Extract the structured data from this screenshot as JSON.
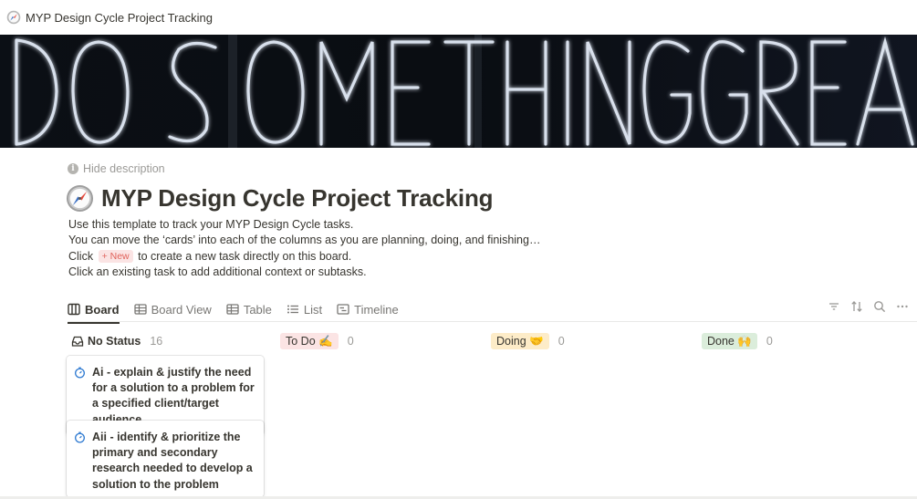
{
  "window": {
    "title": "MYP Design Cycle Project Tracking",
    "icon": "compass-icon"
  },
  "cover": {
    "text": "DO SOMETHING GREAT",
    "style": "neon-sign",
    "colors": {
      "background": "#07090d",
      "glow": "#dfe9f7"
    }
  },
  "description_toggle": {
    "label": "Hide description",
    "icon": "info-icon"
  },
  "page": {
    "title": "MYP Design Cycle Project Tracking",
    "icon": "compass-icon",
    "description": {
      "line1": "Use this template to track your MYP Design Cycle tasks.",
      "line2": "You can move the ‘cards’ into each of the columns as you are planning, doing, and finishing…",
      "line3_before": "Click",
      "line3_chip": "+ New",
      "line3_after": "to create a new task directly on this board.",
      "line4": "Click an existing task to add additional context or subtasks."
    }
  },
  "views": {
    "tabs": [
      {
        "label": "Board",
        "icon": "board-icon",
        "active": true
      },
      {
        "label": "Board View",
        "icon": "table-icon",
        "active": false
      },
      {
        "label": "Table",
        "icon": "table-icon",
        "active": false
      },
      {
        "label": "List",
        "icon": "list-icon",
        "active": false
      },
      {
        "label": "Timeline",
        "icon": "timeline-icon",
        "active": false
      }
    ],
    "toolbar": [
      "filter-icon",
      "sort-icon",
      "search-icon",
      "more-icon"
    ]
  },
  "board": {
    "columns": [
      {
        "label": "No Status",
        "count": "16",
        "icon": "inbox-icon"
      },
      {
        "label": "To Do ✍️",
        "count": "0",
        "color": "#fbe4e4"
      },
      {
        "label": "Doing 🤝",
        "count": "0",
        "color": "#fdecc8"
      },
      {
        "label": "Done 🙌",
        "count": "0",
        "color": "#dbeddb"
      }
    ],
    "cards": [
      {
        "text": "Ai - explain & justify the need for a solution to a problem for a specified client/target audience",
        "icon": "stopwatch-icon"
      },
      {
        "text": "Aii - identify & prioritize the primary and secondary research needed to develop a solution to the problem",
        "icon": "stopwatch-icon"
      }
    ]
  },
  "colors": {
    "accent_text": "#37352f",
    "muted_text": "#9b9a97",
    "new_chip": "#e0625a",
    "card_icon": "#2e7ad1"
  }
}
